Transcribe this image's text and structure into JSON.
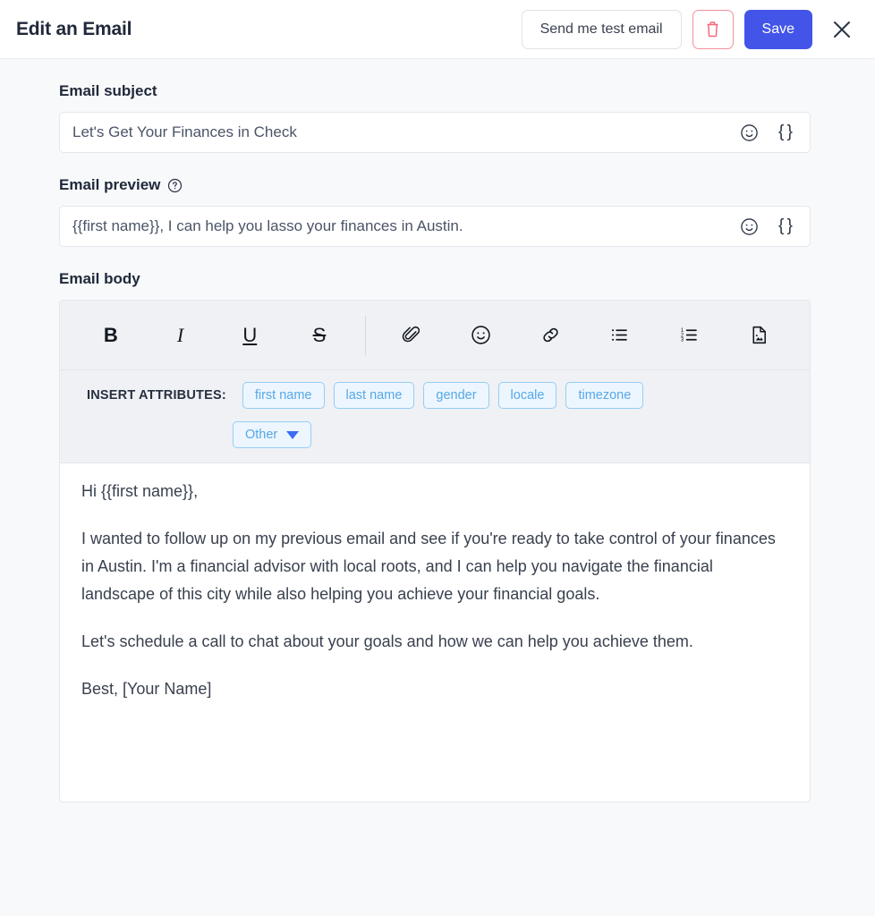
{
  "header": {
    "title": "Edit an Email",
    "send_test_label": "Send me test email",
    "delete_icon": "trash-icon",
    "save_label": "Save",
    "close_icon": "close-icon",
    "save_color": "#4355e8",
    "delete_color": "#f4697c"
  },
  "subject": {
    "label": "Email subject",
    "value": "Let's Get Your Finances in Check",
    "placeholder": "Email subject",
    "emoji_icon": "emoji-icon",
    "merge_tag_icon": "{ }"
  },
  "preview": {
    "label": "Email preview",
    "help_icon": "help-circle-icon",
    "value": "{{first name}}, I can help you lasso your finances in Austin.",
    "placeholder": "Email preview",
    "emoji_icon": "emoji-icon",
    "merge_tag_icon": "{ }"
  },
  "body": {
    "label": "Email body",
    "toolbar": [
      {
        "name": "bold-icon",
        "glyph": "B"
      },
      {
        "name": "italic-icon",
        "glyph": "I"
      },
      {
        "name": "underline-icon",
        "glyph": "U"
      },
      {
        "name": "strikethrough-icon",
        "glyph": "S"
      },
      {
        "name": "attachment-icon",
        "glyph": ""
      },
      {
        "name": "emoji-icon",
        "glyph": ""
      },
      {
        "name": "link-icon",
        "glyph": ""
      },
      {
        "name": "bulleted-list-icon",
        "glyph": ""
      },
      {
        "name": "numbered-list-icon",
        "glyph": ""
      },
      {
        "name": "insert-image-icon",
        "glyph": ""
      }
    ],
    "attributes_title": "INSERT ATTRIBUTES:",
    "attributes": [
      "first name",
      "last name",
      "gender",
      "locale",
      "timezone"
    ],
    "other_label": "Other",
    "paragraphs": [
      "Hi {{first name}},",
      "I wanted to follow up on my previous email and see if you're ready to take control of your finances in Austin. I'm a financial advisor with local roots, and I can help you navigate the financial landscape of this city while also helping you achieve your financial goals.",
      "Let's schedule a call to chat about your goals and how we can help you achieve them.",
      "Best, [Your Name]"
    ]
  }
}
